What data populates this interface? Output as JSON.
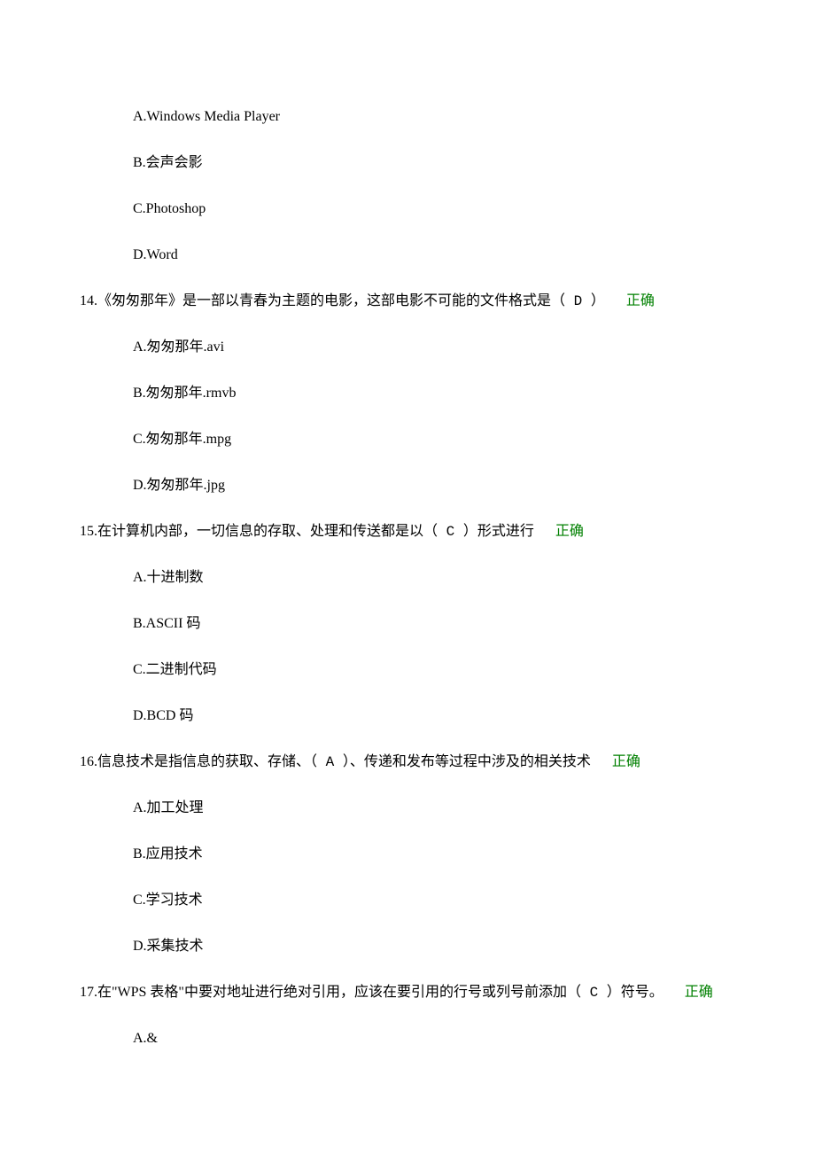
{
  "q13_options": {
    "a": "A.Windows Media Player",
    "b": "B.会声会影",
    "c": "C.Photoshop",
    "d": "D.Word"
  },
  "q14": {
    "num": "14.",
    "text_before": "《匆匆那年》是一部以青春为主题的电影，这部电影不可能的文件格式是（",
    "answer": "  D  ",
    "text_after": "）",
    "correct": "正确",
    "options": {
      "a": "A.匆匆那年.avi",
      "b": "B.匆匆那年.rmvb",
      "c": "C.匆匆那年.mpg",
      "d": "D.匆匆那年.jpg"
    }
  },
  "q15": {
    "num": "15.",
    "text_before": "在计算机内部，一切信息的存取、处理和传送都是以（",
    "answer": "  C  ",
    "text_after": "）形式进行",
    "correct": "正确",
    "options": {
      "a": "A.十进制数",
      "b": "B.ASCII 码",
      "c": "C.二进制代码",
      "d": "D.BCD 码"
    }
  },
  "q16": {
    "num": "16.",
    "text_before": "信息技术是指信息的获取、存储、（",
    "answer": "  A  ",
    "text_after": "）、传递和发布等过程中涉及的相关技术",
    "correct": "正确",
    "options": {
      "a": "A.加工处理",
      "b": "B.应用技术",
      "c": "C.学习技术",
      "d": "D.采集技术"
    }
  },
  "q17": {
    "num": "17.",
    "text_before": "在\"WPS 表格\"中要对地址进行绝对引用，应该在要引用的行号或列号前添加（",
    "answer": "  C  ",
    "text_after": "）符号。",
    "correct": "正确",
    "options": {
      "a": "A.&"
    }
  }
}
